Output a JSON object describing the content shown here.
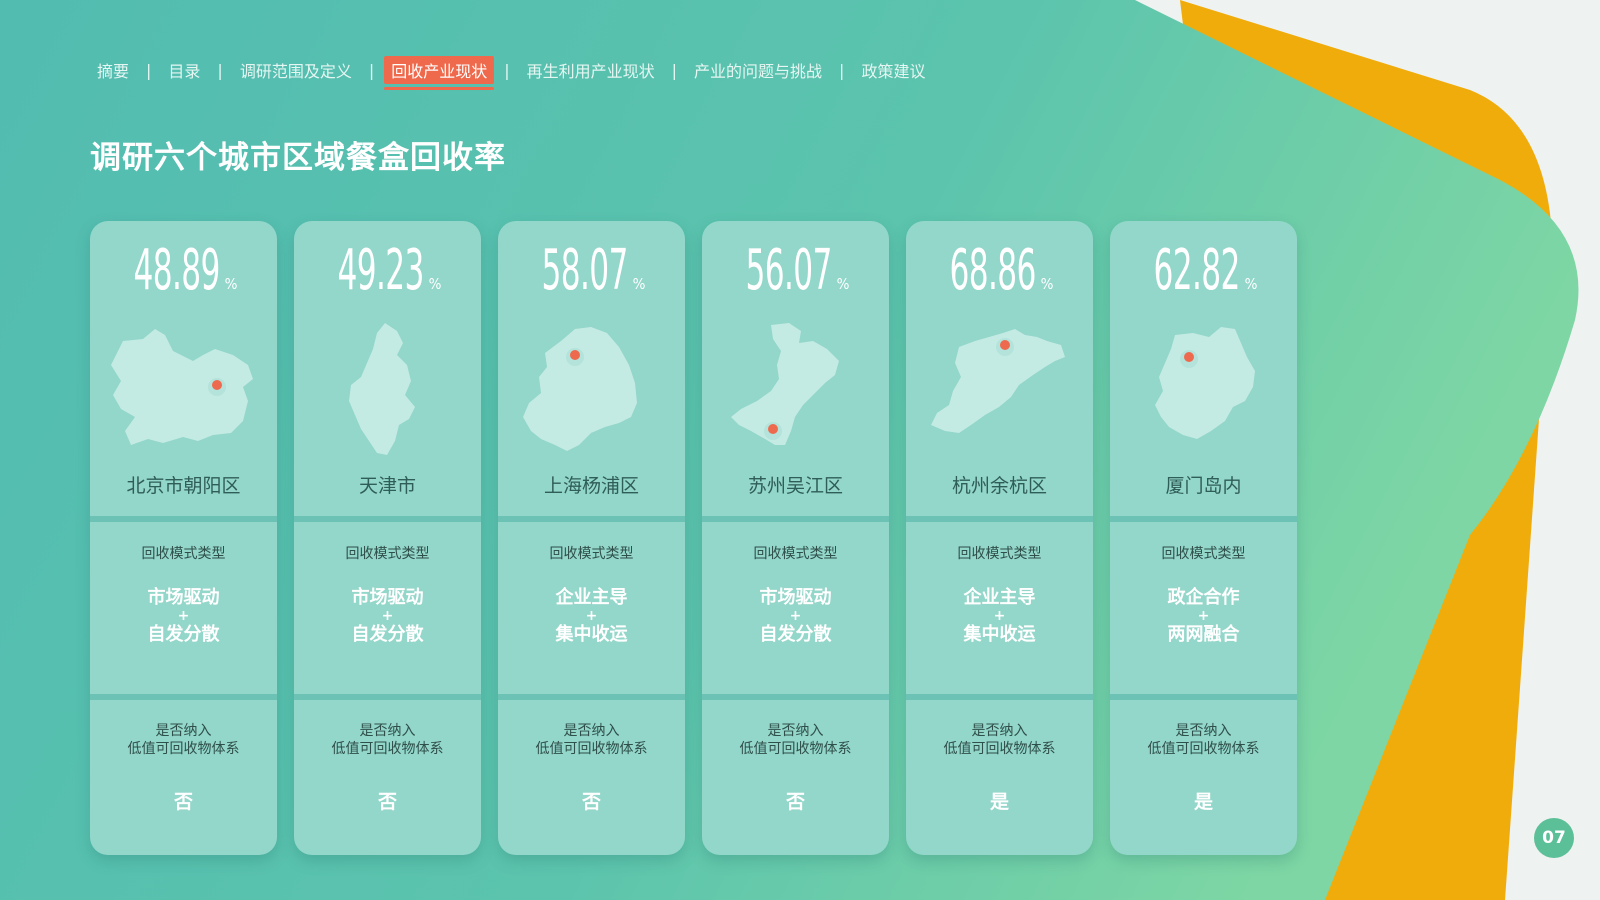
{
  "nav": {
    "items": [
      {
        "label": "摘要",
        "active": false
      },
      {
        "label": "目录",
        "active": false
      },
      {
        "label": "调研范围及定义",
        "active": false
      },
      {
        "label": "回收产业现状",
        "active": true
      },
      {
        "label": "再生利用产业现状",
        "active": false
      },
      {
        "label": "产业的问题与挑战",
        "active": false
      },
      {
        "label": "政策建议",
        "active": false
      }
    ],
    "separator": "|"
  },
  "title": "调研六个城市区域餐盒回收率",
  "common_labels": {
    "percent": "%",
    "mode_label": "回收模式类型",
    "plus": "+",
    "system_label_line1": "是否纳入",
    "system_label_line2": "低值可回收物体系"
  },
  "cards": [
    {
      "rate": "48.89",
      "city": "北京市朝阳区",
      "mode_line1": "市场驱动",
      "mode_line2": "自发分散",
      "included": "否",
      "map_icon": "beijing-chaoyang-map"
    },
    {
      "rate": "49.23",
      "city": "天津市",
      "mode_line1": "市场驱动",
      "mode_line2": "自发分散",
      "included": "否",
      "map_icon": "tianjin-map"
    },
    {
      "rate": "58.07",
      "city": "上海杨浦区",
      "mode_line1": "企业主导",
      "mode_line2": "集中收运",
      "included": "否",
      "map_icon": "shanghai-yangpu-map"
    },
    {
      "rate": "56.07",
      "city": "苏州吴江区",
      "mode_line1": "市场驱动",
      "mode_line2": "自发分散",
      "included": "否",
      "map_icon": "suzhou-wujiang-map"
    },
    {
      "rate": "68.86",
      "city": "杭州余杭区",
      "mode_line1": "企业主导",
      "mode_line2": "集中收运",
      "included": "是",
      "map_icon": "hangzhou-yuhang-map"
    },
    {
      "rate": "62.82",
      "city": "厦门岛内",
      "mode_line1": "政企合作",
      "mode_line2": "两网融合",
      "included": "是",
      "map_icon": "xiamen-island-map"
    }
  ],
  "page_number": "07",
  "colors": {
    "accent": "#ef6a4c",
    "card_bg": "#93d6ca",
    "teal_bg": "#55bfb0",
    "orange_shape": "#f0ac0a",
    "marker": "#ee6a4f",
    "map_fill": "#c3ebe4"
  }
}
